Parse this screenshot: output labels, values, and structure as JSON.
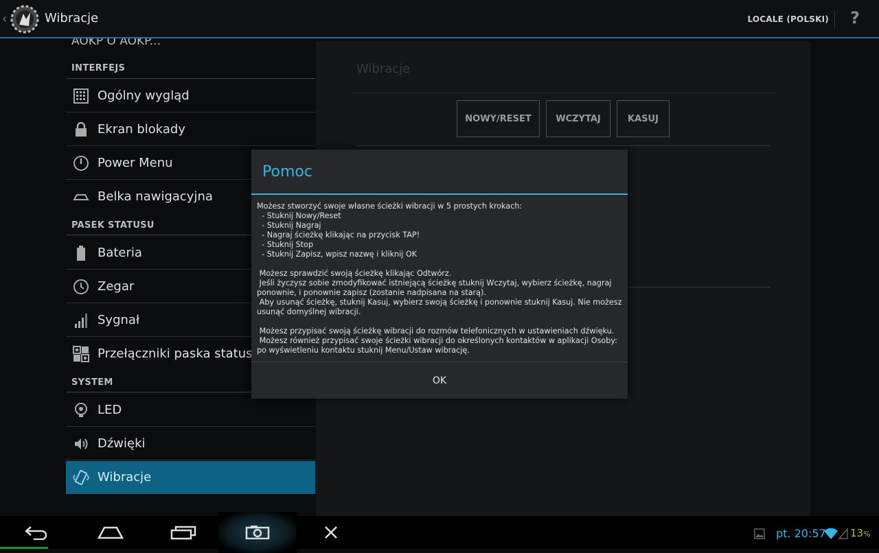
{
  "actionbar": {
    "title": "Wibracje",
    "locale_label": "LOCALE (POLSKI)",
    "help_label": "?"
  },
  "settings_list": {
    "truncated_item": "AOKP O AOKP...",
    "sections": [
      {
        "title": "INTERFEJS",
        "items": [
          {
            "label": "Ogólny wygląd",
            "icon": "grid-icon"
          },
          {
            "label": "Ekran blokady",
            "icon": "lock-icon"
          },
          {
            "label": "Power Menu",
            "icon": "power-icon"
          },
          {
            "label": "Belka nawigacyjna",
            "icon": "navbar-icon"
          }
        ]
      },
      {
        "title": "PASEK STATUSU",
        "items": [
          {
            "label": "Bateria",
            "icon": "battery-icon"
          },
          {
            "label": "Zegar",
            "icon": "clock-icon"
          },
          {
            "label": "Sygnał",
            "icon": "signal-icon"
          },
          {
            "label": "Przełączniki paska statusu",
            "icon": "toggles-icon"
          }
        ]
      },
      {
        "title": "SYSTEM",
        "items": [
          {
            "label": "LED",
            "icon": "bulb-icon"
          },
          {
            "label": "Dźwięki",
            "icon": "speaker-icon"
          },
          {
            "label": "Wibracje",
            "icon": "vibrate-icon",
            "selected": true
          }
        ]
      }
    ]
  },
  "content": {
    "title": "Wibracje",
    "buttons": [
      "NOWY/RESET",
      "WCZYTAJ",
      "KASUJ"
    ]
  },
  "dialog": {
    "title": "Pomoc",
    "message": "Możesz stworzyć swoje własne ścieżki wibracji w 5 prostych krokach:\n  - Stuknij Nowy/Reset\n  - Stuknij Nagraj\n  - Nagraj ścieżkę klikając na przycisk TAP!\n  - Stuknij Stop\n  - Stuknij Zapisz, wpisz nazwę i kliknij OK\n\n Możesz sprawdzić swoją ścieżkę klikając Odtwórz.\n Jeśli życzysz sobie zmodyfikować istniejącą ścieżkę stuknij Wczytaj, wybierz ścieżkę, nagraj ponownie, i ponownie zapisz (zostanie nadpisana na starą).\n Aby usunąć ścieżkę, stuknij Kasuj, wybierz swoją ścieżkę i ponownie stuknij Kasuj. Nie możesz usunąć domyślnej wibracji.\n\n Możesz przypisać swoją ścieżkę wibracji do rozmów telefonicznych w ustawieniach dźwięku.\n Możesz również przypisać swoje ścieżki wibracji do określonych kontaktów w aplikacji Osoby: po wyświetleniu kontaktu stuknij Menu/Ustaw wibrację.",
    "ok_label": "OK"
  },
  "system_bar": {
    "clock": "pt. 20:57",
    "battery_pct": "13",
    "battery_unit": "%",
    "icons": [
      "back-icon",
      "home-icon",
      "recents-icon",
      "screenshot-icon",
      "close-icon",
      "notification-image-icon",
      "wifi-icon",
      "signal-icon"
    ],
    "accent_color": "#33b5e5",
    "battery_color": "#9ccc2a"
  }
}
